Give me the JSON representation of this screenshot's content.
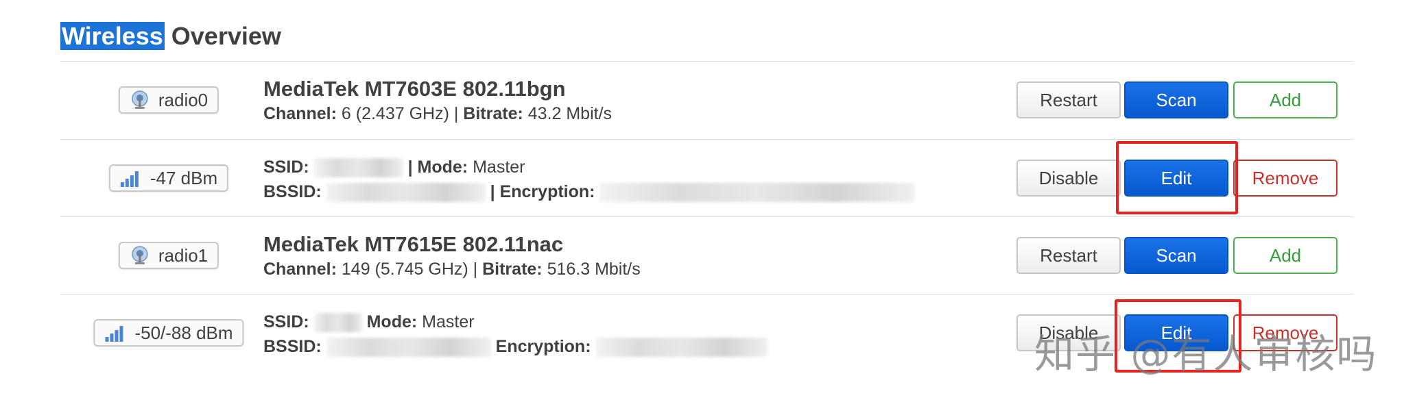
{
  "title": {
    "highlight": "Wireless",
    "rest": " Overview"
  },
  "rows": [
    {
      "badge": {
        "icon": "wireless-radio-icon",
        "text": "radio0"
      },
      "name": "MediaTek MT7603E 802.11bgn",
      "channel_label": "Channel:",
      "channel_value": " 6 (2.437 GHz) | ",
      "bitrate_label": "Bitrate:",
      "bitrate_value": " 43.2 Mbit/s",
      "buttons": [
        "Restart",
        "Scan",
        "Add"
      ]
    },
    {
      "badge": {
        "icon": "signal-bars-icon",
        "text": "-47 dBm"
      },
      "ssid_label": "SSID:",
      "mode_label": "| Mode:",
      "mode_value": " Master",
      "bssid_label": "BSSID:",
      "encryption_label": "| Encryption:",
      "buttons": [
        "Disable",
        "Edit",
        "Remove"
      ]
    },
    {
      "badge": {
        "icon": "wireless-radio-icon",
        "text": "radio1"
      },
      "name": "MediaTek MT7615E 802.11nac",
      "channel_label": "Channel:",
      "channel_value": " 149 (5.745 GHz) | ",
      "bitrate_label": "Bitrate:",
      "bitrate_value": " 516.3 Mbit/s",
      "buttons": [
        "Restart",
        "Scan",
        "Add"
      ]
    },
    {
      "badge": {
        "icon": "signal-bars-icon",
        "text": "-50/-88 dBm"
      },
      "ssid_label": "SSID:",
      "mode_label": "Mode:",
      "mode_value": " Master",
      "bssid_label": "BSSID:",
      "encryption_label": "Encryption:",
      "buttons": [
        "Disable",
        "Edit",
        "Remove"
      ]
    }
  ],
  "watermark": "知乎 @有人审核吗",
  "colors": {
    "primary": "#0a64e0",
    "add": "#4caf50",
    "remove": "#c9302c",
    "annotation": "#e8231f"
  }
}
